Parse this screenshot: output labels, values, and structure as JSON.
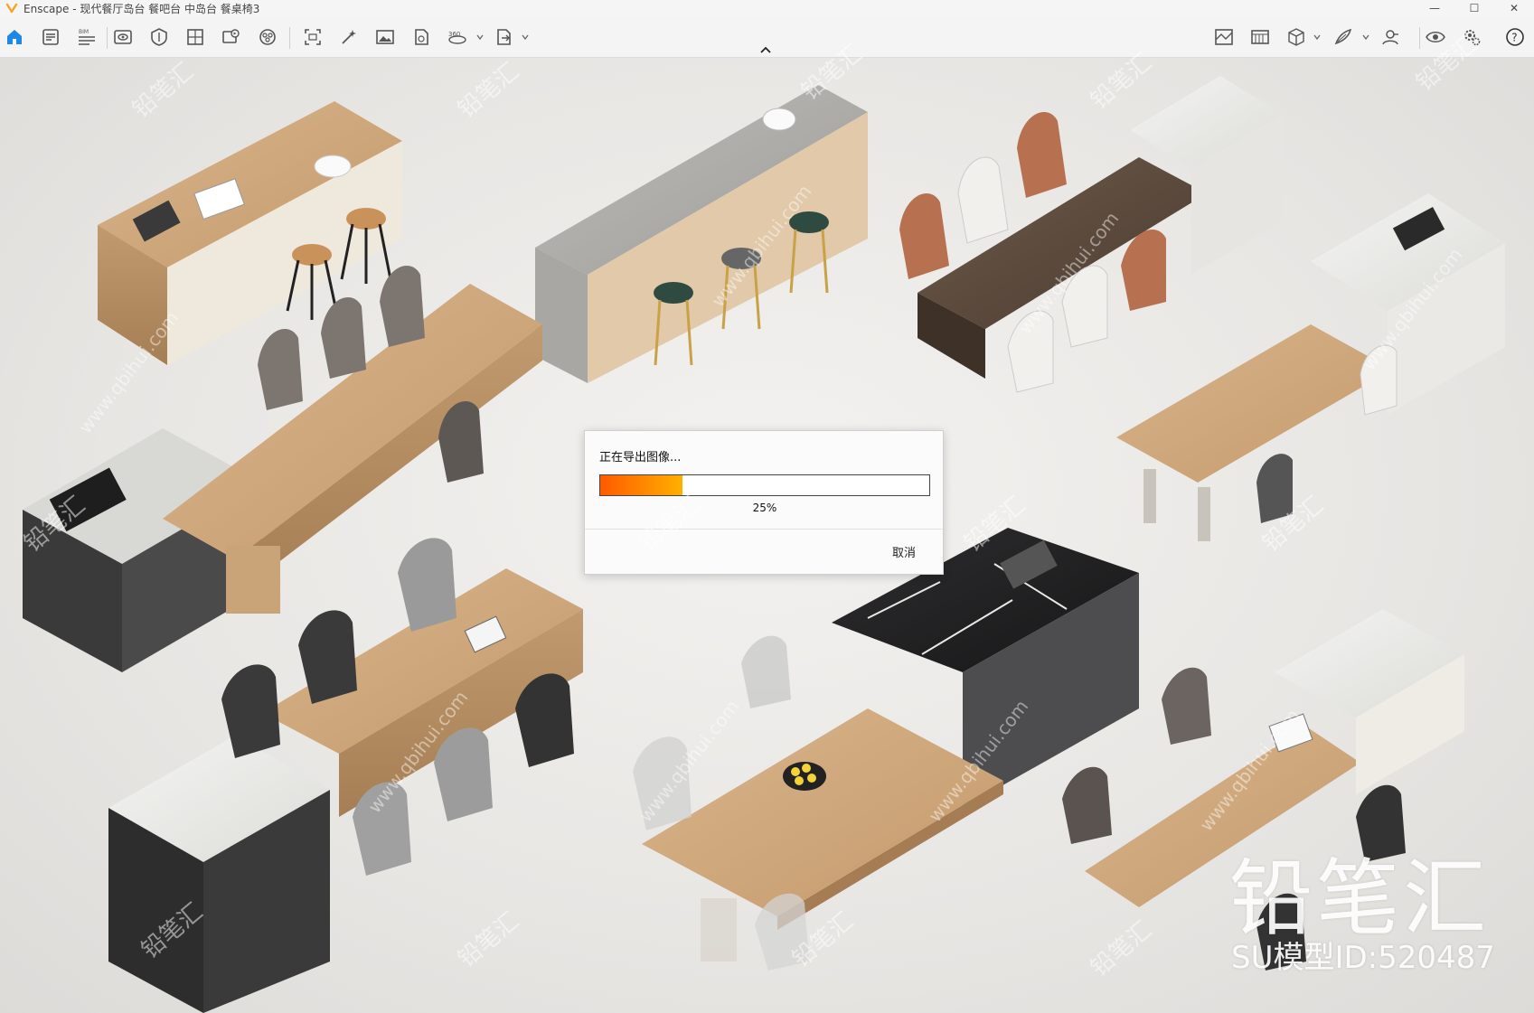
{
  "window": {
    "title": "Enscape - 现代餐厅岛台 餐吧台 中岛台 餐桌椅3",
    "minimize": "—",
    "maximize": "☐",
    "close": "✕"
  },
  "toolbar": {
    "bim_label": "BIM",
    "icons_left": [
      "home-icon",
      "assets-icon",
      "bim-icon",
      "view-icon",
      "visual-settings-icon",
      "material-editor-icon",
      "video-editor-icon",
      "vr-icon",
      "screenshot-icon",
      "render-icon",
      "image-icon",
      "batch-render-icon",
      "panorama-icon",
      "export-icon"
    ],
    "icons_right": [
      "site-context-icon",
      "minimap-icon",
      "cube-icon",
      "sketch-icon",
      "presentation-icon",
      "visibility-icon",
      "settings-icon",
      "help-icon"
    ],
    "help_glyph": "?"
  },
  "dialog": {
    "message": "正在导出图像...",
    "progress_value": 0.25,
    "progress_text": "25%",
    "cancel_label": "取消"
  },
  "watermark": {
    "brand": "铅笔汇",
    "model_id": "SU模型ID:520487",
    "tile": "铅笔汇",
    "url": "www.qbihui.com"
  },
  "colors": {
    "accent": "#1e88e5",
    "progress_start": "#ff5a00",
    "progress_end": "#ffb000",
    "app_logo": "#f5a623"
  }
}
